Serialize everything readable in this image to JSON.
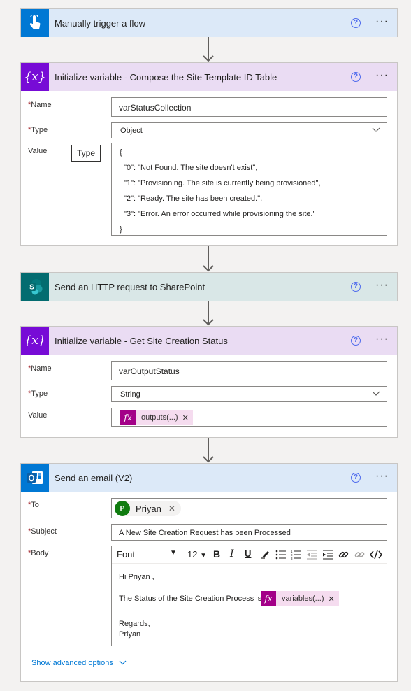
{
  "trigger": {
    "title": "Manually trigger a flow"
  },
  "init_var1": {
    "title": "Initialize variable - Compose the Site Template ID Table",
    "name_label": "Name",
    "name_value": "varStatusCollection",
    "type_label": "Type",
    "type_value": "Object",
    "value_label": "Value",
    "tooltip": "Type",
    "json_lines": [
      "{",
      "  \"0\": \"Not Found. The site doesn't exist\",",
      "  \"1\": \"Provisioning. The site is currently being provisioned\",",
      "  \"2\": \"Ready. The site has been created.\",",
      "  \"3\": \"Error. An error occurred while provisioning the site.\"",
      "}"
    ]
  },
  "sharepoint": {
    "title": "Send an HTTP request to SharePoint"
  },
  "init_var2": {
    "title": "Initialize variable - Get Site Creation Status",
    "name_label": "Name",
    "name_value": "varOutputStatus",
    "type_label": "Type",
    "type_value": "String",
    "value_label": "Value",
    "token_label": "outputs(...)"
  },
  "email": {
    "title": "Send an email (V2)",
    "to_label": "To",
    "recipient_initial": "P",
    "recipient_name": "Priyan",
    "subject_label": "Subject",
    "subject_value": "A New Site Creation Request has been Processed",
    "body_label": "Body",
    "toolbar": {
      "font": "Font",
      "size": "12"
    },
    "body_greeting": "Hi Priyan ,",
    "body_status_text": "The Status of the Site Creation Process is :",
    "body_token": "variables(...)",
    "body_regards": "Regards,",
    "body_signature": "Priyan",
    "advanced_link": "Show advanced options"
  },
  "colors": {
    "trigger_header": "#dce9f8",
    "variable_header": "#eadcf3",
    "variable_icon": "#770bd6",
    "sharepoint_header": "#d9e7e7",
    "sharepoint_icon": "#036c70",
    "expression_token": "#a30088",
    "link": "#0078d4"
  }
}
